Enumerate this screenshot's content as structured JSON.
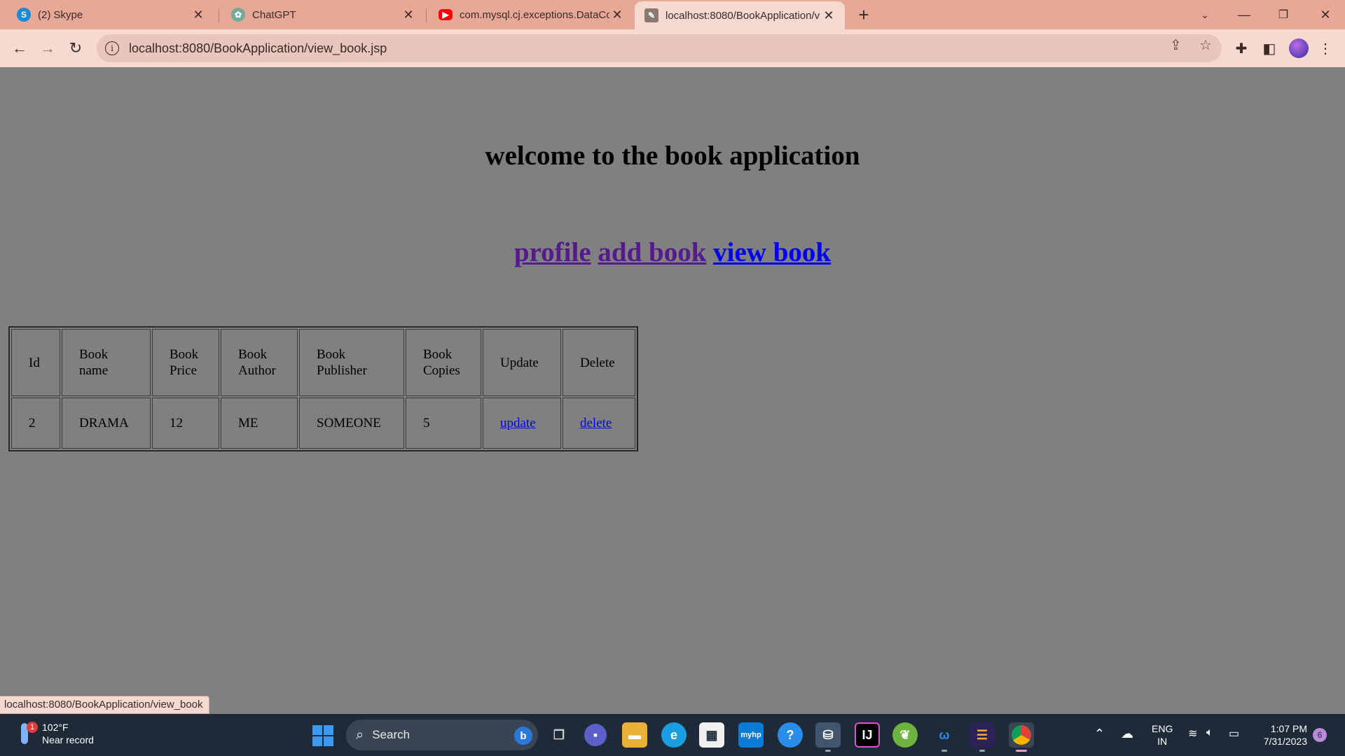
{
  "browser": {
    "tabs": [
      {
        "label": "(2) Skype",
        "icon": "skype-icon",
        "color": "#1a8ad4"
      },
      {
        "label": "ChatGPT",
        "icon": "chatgpt-icon",
        "color": "#74aa9c"
      },
      {
        "label": "com.mysql.cj.exceptions.DataCon",
        "icon": "youtube-icon",
        "color": "#ff0000"
      },
      {
        "label": "localhost:8080/BookApplication/v",
        "icon": "page-icon",
        "color": "#8a7a70"
      }
    ],
    "url": "localhost:8080/BookApplication/view_book.jsp",
    "status_url": "localhost:8080/BookApplication/view_book"
  },
  "page": {
    "heading": "welcome to the book application",
    "nav": {
      "profile": "profile",
      "add_book": "add book",
      "view_book": "view book"
    },
    "table": {
      "headers": {
        "id": "Id",
        "name_1": "Book",
        "name_2": "name",
        "price_1": "Book",
        "price_2": "Price",
        "author_1": "Book",
        "author_2": "Author",
        "publisher_1": "Book",
        "publisher_2": "Publisher",
        "copies_1": "Book",
        "copies_2": "Copies",
        "update": "Update",
        "delete": "Delete"
      },
      "rows": [
        {
          "id": "2",
          "name": "DRAMA",
          "price": "12",
          "author": "ME",
          "publisher": "SOMEONE",
          "copies": "5",
          "update": "update",
          "delete": "delete"
        }
      ]
    }
  },
  "taskbar": {
    "weather_temp": "102°F",
    "weather_desc": "Near record",
    "weather_badge": "1",
    "search_placeholder": "Search",
    "lang_1": "ENG",
    "lang_2": "IN",
    "time": "1:07 PM",
    "date": "7/31/2023",
    "notifications": "6"
  }
}
